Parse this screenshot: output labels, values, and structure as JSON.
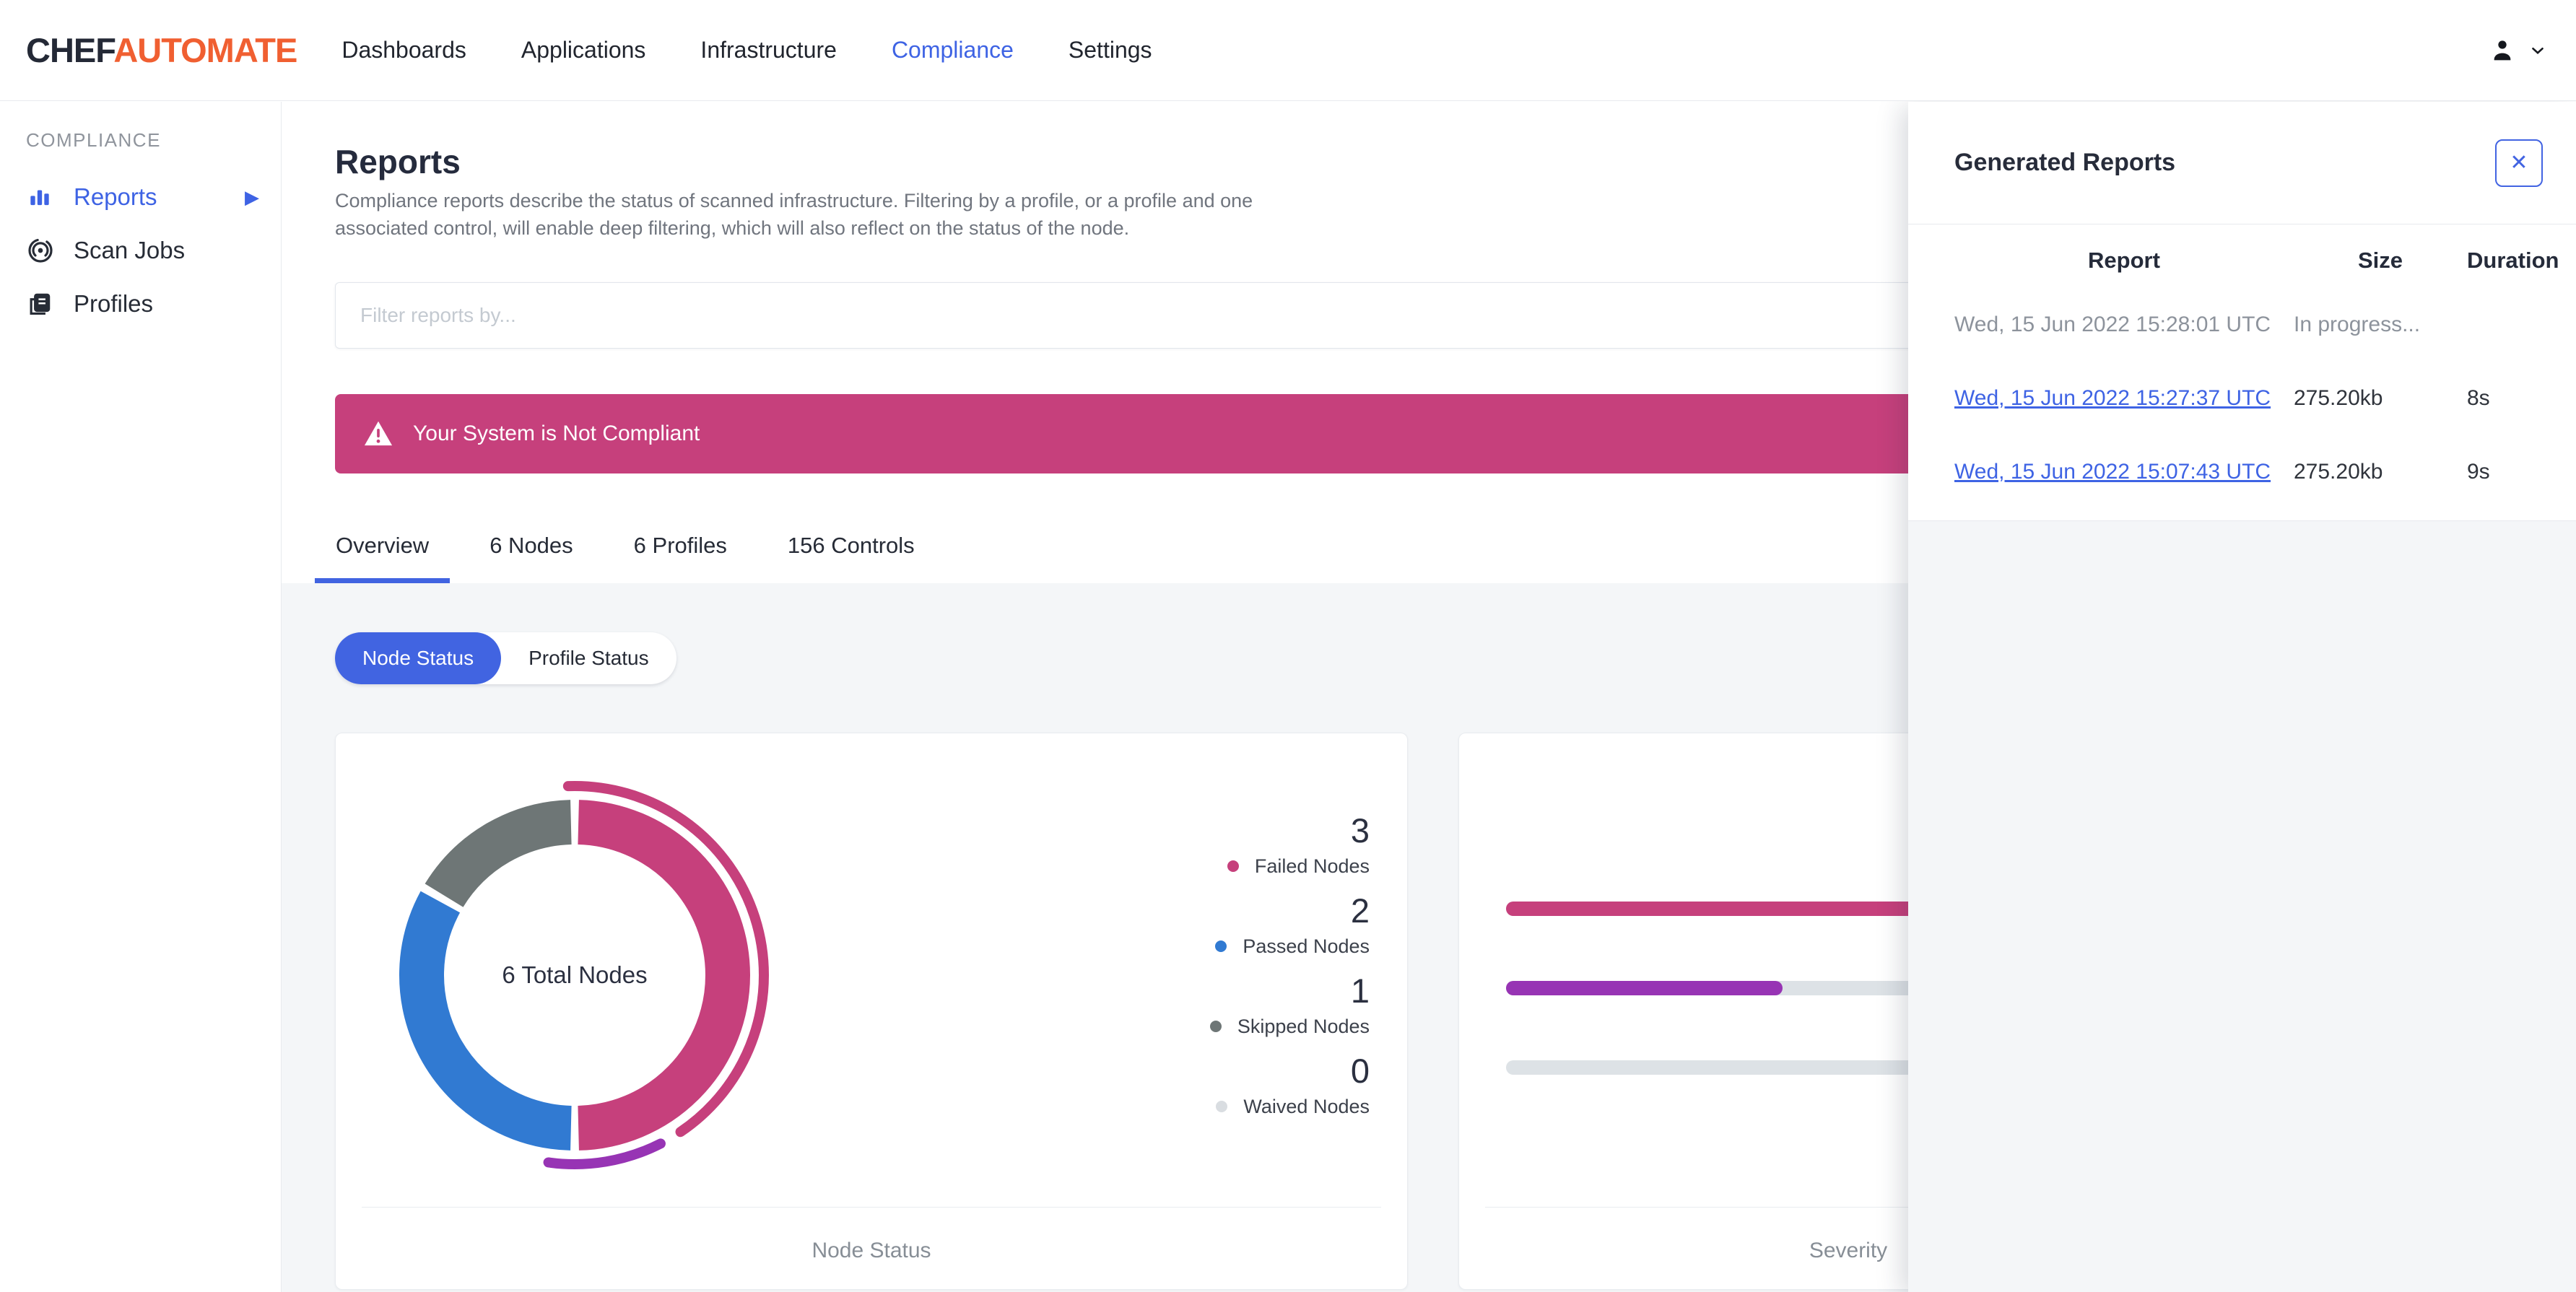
{
  "nav": {
    "logo_chef": "CHEF",
    "logo_automate": "AUTOMATE",
    "items": [
      {
        "label": "Dashboards",
        "active": false
      },
      {
        "label": "Applications",
        "active": false
      },
      {
        "label": "Infrastructure",
        "active": false
      },
      {
        "label": "Compliance",
        "active": true
      },
      {
        "label": "Settings",
        "active": false
      }
    ]
  },
  "sidebar": {
    "section_label": "COMPLIANCE",
    "items": [
      {
        "label": "Reports",
        "icon": "bar-chart-icon",
        "active": true,
        "has_submenu": true
      },
      {
        "label": "Scan Jobs",
        "icon": "scan-target-icon",
        "active": false
      },
      {
        "label": "Profiles",
        "icon": "documents-icon",
        "active": false
      }
    ],
    "submenu_arrow": "▶"
  },
  "page": {
    "title": "Reports",
    "description": "Compliance reports describe the status of scanned infrastructure. Filtering by a profile, or a profile and one associated control, will enable deep filtering, which will also reflect on the status of the node."
  },
  "filter": {
    "placeholder": "Filter reports by..."
  },
  "banner": {
    "text": "Your System is Not Compliant",
    "color": "#c6407c"
  },
  "tabs": [
    {
      "label": "Overview",
      "active": true
    },
    {
      "label": "6 Nodes",
      "active": false
    },
    {
      "label": "6 Profiles",
      "active": false
    },
    {
      "label": "156 Controls",
      "active": false
    }
  ],
  "toggle": [
    {
      "label": "Node Status",
      "active": true
    },
    {
      "label": "Profile Status",
      "active": false
    }
  ],
  "panel": {
    "title": "Generated Reports",
    "close_glyph": "✕",
    "columns": [
      "Report",
      "Size",
      "Duration"
    ],
    "rows": [
      {
        "report": "Wed, 15 Jun 2022 15:28:01 UTC",
        "size": "In progress...",
        "duration": "",
        "is_link": false
      },
      {
        "report": "Wed, 15 Jun 2022 15:27:37 UTC",
        "size": "275.20kb",
        "duration": "8s",
        "is_link": true
      },
      {
        "report": "Wed, 15 Jun 2022 15:07:43 UTC",
        "size": "275.20kb",
        "duration": "9s",
        "is_link": true
      }
    ]
  },
  "colors": {
    "primary_blue": "#4164e1",
    "link_blue": "#3e63e4",
    "banner_pink": "#c6407c",
    "donut_failed": "#c6407c",
    "donut_passed": "#317ad2",
    "donut_skipped": "#6e7676",
    "donut_waived": "#d9dde1",
    "outer_purple": "#9734b4",
    "gray_bg": "#f4f6f8"
  },
  "chart_data": [
    {
      "type": "pie",
      "subtype": "donut",
      "title": "Node Status",
      "center_label": "6 Total Nodes",
      "labels": [
        "Failed Nodes",
        "Passed Nodes",
        "Skipped Nodes",
        "Waived Nodes"
      ],
      "values": [
        3,
        2,
        1,
        0
      ],
      "colors": [
        "#c6407c",
        "#317ad2",
        "#6e7676",
        "#d9dde1"
      ],
      "legend_position": "right",
      "outer_arcs": [
        {
          "start_deg": -2,
          "end_deg": 146,
          "color": "#c6407c"
        },
        {
          "start_deg": 153,
          "end_deg": 188,
          "color": "#9734b4"
        }
      ]
    },
    {
      "type": "bar",
      "orientation": "horizontal",
      "title": "Severity",
      "categories": [
        "",
        "",
        ""
      ],
      "values_pct": [
        100,
        58,
        0
      ],
      "colors": [
        "#c6407c",
        "#9734b4",
        "#dde2e6"
      ],
      "track_color": "#dde2e6"
    }
  ]
}
